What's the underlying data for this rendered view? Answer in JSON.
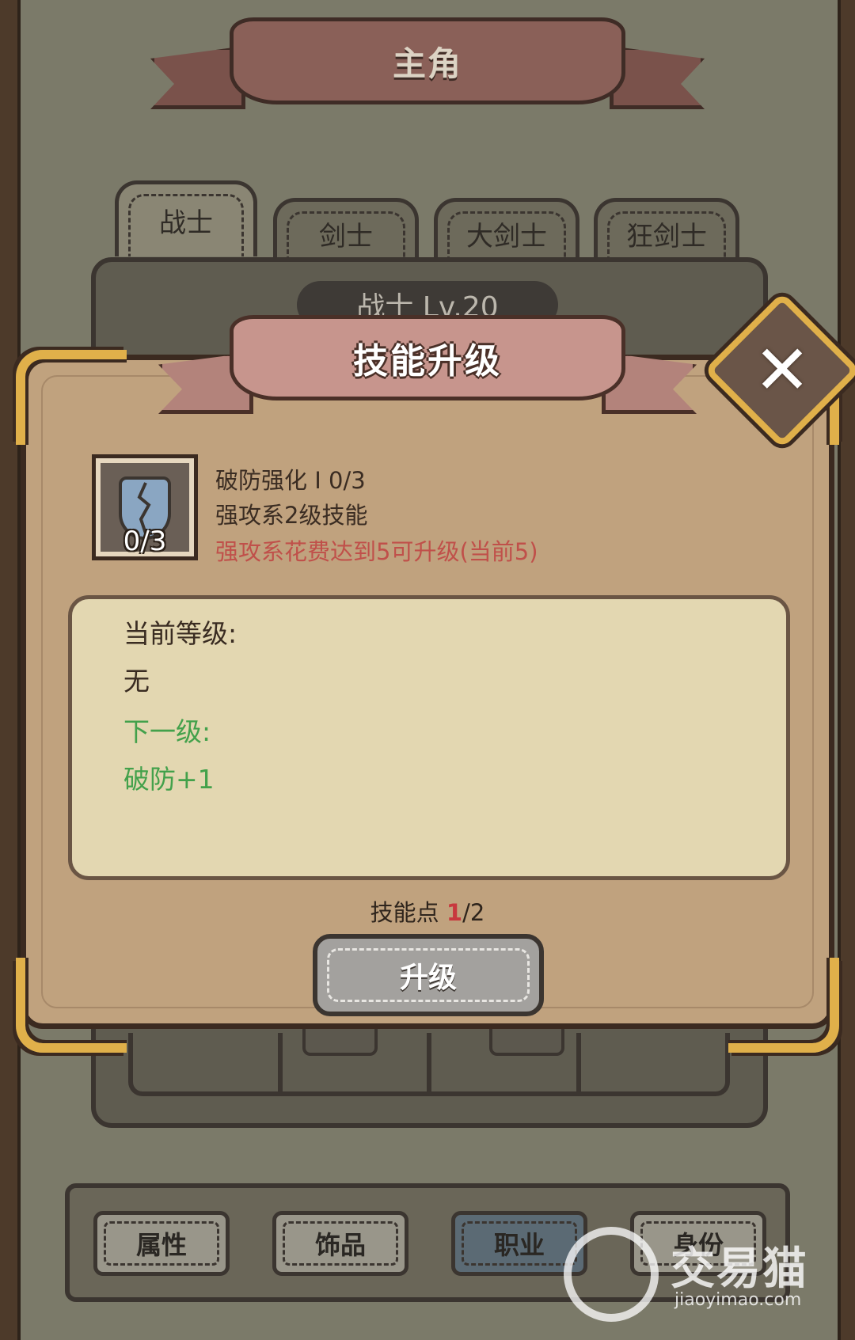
{
  "header": {
    "title": "主角"
  },
  "class_tabs": [
    {
      "label": "战士",
      "active": true
    },
    {
      "label": "剑士",
      "active": false
    },
    {
      "label": "大剑士",
      "active": false
    },
    {
      "label": "狂剑士",
      "active": false
    }
  ],
  "panel": {
    "level_label": "战士 Lv.20"
  },
  "bottom_nav": [
    {
      "label": "属性"
    },
    {
      "label": "饰品"
    },
    {
      "label": "职业"
    },
    {
      "label": "身份"
    }
  ],
  "modal": {
    "title": "技能升级",
    "close_icon": "close-icon",
    "skill": {
      "icon": "broken-shield-icon",
      "count": "0/3",
      "name": "破防强化 I  0/3",
      "description": "强攻系2级技能",
      "requirement": "强攻系花费达到5可升级(当前5)"
    },
    "info": {
      "current_label": "当前等级:",
      "current_value": "无",
      "next_label": "下一级:",
      "next_value": "破防+1"
    },
    "skill_points_label": "技能点",
    "skill_points_current": "1",
    "skill_points_total": "/2",
    "upgrade_label": "升级"
  },
  "watermark": {
    "text": "交易猫",
    "sub": "jiaoyimao.com"
  },
  "colors": {
    "requirement_red": "#c0504a",
    "next_green": "#43a14b",
    "gold_trim": "#e0b04a"
  }
}
